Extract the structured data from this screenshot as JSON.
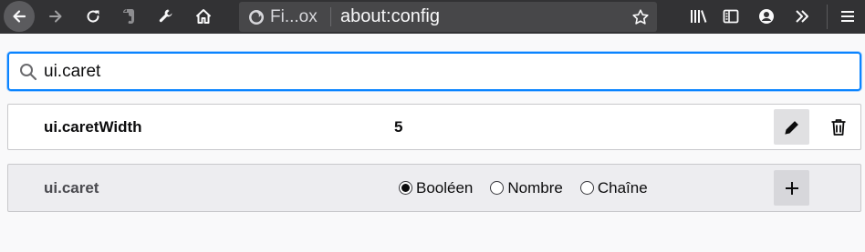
{
  "browser": {
    "identity_label": "Fi...ox",
    "url": "about:config"
  },
  "search": {
    "value": "ui.caret"
  },
  "prefs": [
    {
      "name": "ui.caretWidth",
      "value": "5"
    },
    {
      "name": "ui.caret",
      "types": [
        "Booléen",
        "Nombre",
        "Chaîne"
      ],
      "selected_type": "Booléen"
    }
  ],
  "colors": {
    "toolbar": "#323234",
    "accent": "#0a84ff",
    "new_row_bg": "#ededf0"
  }
}
